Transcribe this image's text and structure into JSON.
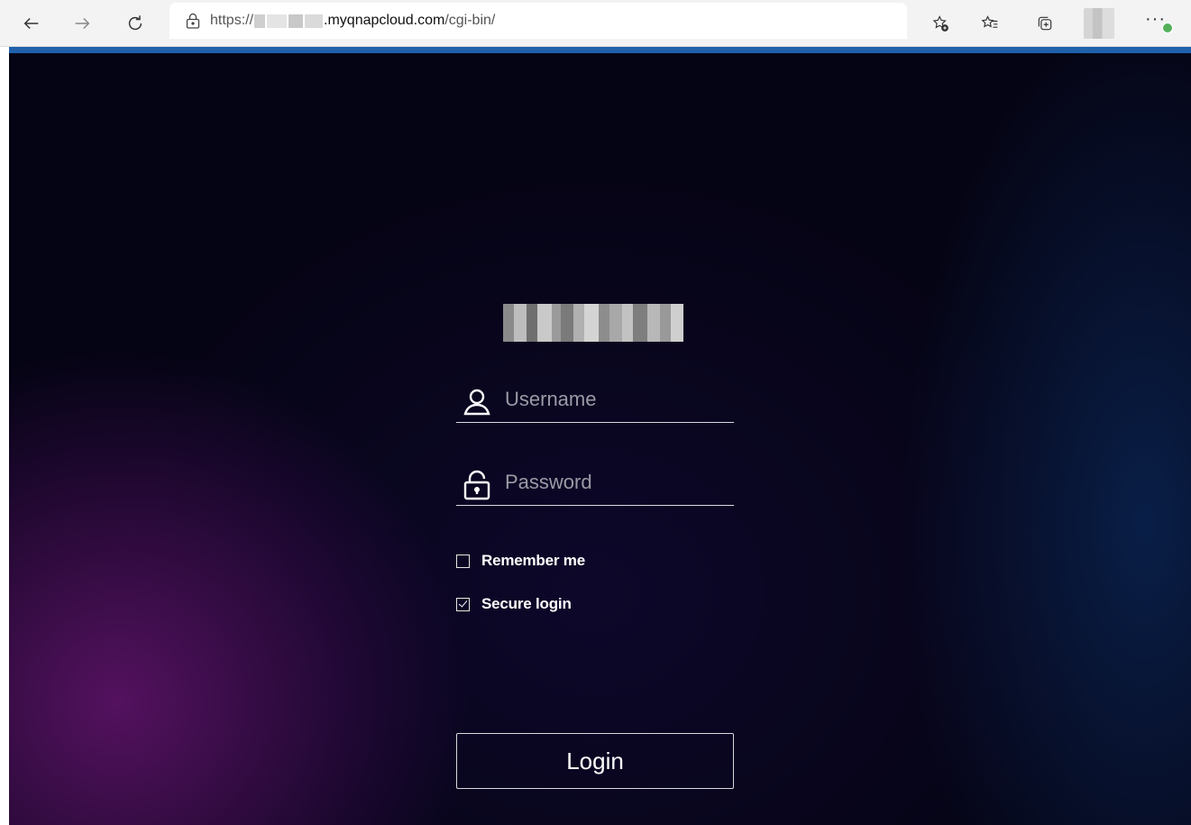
{
  "browser": {
    "url_scheme": "https://",
    "url_domain": ".myqnapcloud.com",
    "url_path": "/cgi-bin/",
    "more_label": "···"
  },
  "login": {
    "username_placeholder": "Username",
    "password_placeholder": "Password",
    "remember_label": "Remember me",
    "remember_checked": false,
    "secure_label": "Secure login",
    "secure_checked": true,
    "login_button": "Login"
  },
  "colors": {
    "accent_line": "#2061ac",
    "page_background": "#050414",
    "purple_glow": "#62146c",
    "badge_green": "#54b05a"
  }
}
